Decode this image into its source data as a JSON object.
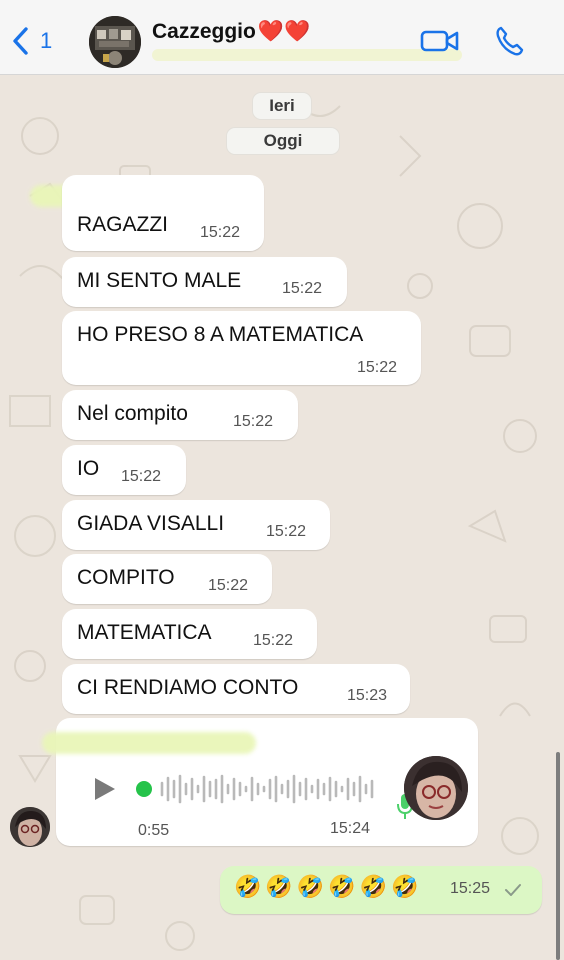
{
  "header": {
    "back_count": "1",
    "title": "Cazzeggio",
    "title_emoji": "❤️❤️"
  },
  "dates": {
    "yesterday": "Ieri",
    "today": "Oggi"
  },
  "messages": [
    {
      "text": "RAGAZZI",
      "time": "15:22"
    },
    {
      "text": "MI SENTO MALE",
      "time": "15:22"
    },
    {
      "text": "HO PRESO 8 A MATEMATICA",
      "time": "15:22"
    },
    {
      "text": "Nel compito",
      "time": "15:22"
    },
    {
      "text": "IO",
      "time": "15:22"
    },
    {
      "text": "GIADA VISALLI",
      "time": "15:22"
    },
    {
      "text": "COMPITO",
      "time": "15:22"
    },
    {
      "text": "MATEMATICA",
      "time": "15:22"
    },
    {
      "text": "CI RENDIAMO CONTO",
      "time": "15:23"
    }
  ],
  "voice_message": {
    "duration": "0:55",
    "time": "15:24",
    "played_fraction": 0.0
  },
  "outgoing": {
    "text": "🤣🤣🤣🤣🤣🤣",
    "time": "15:25"
  },
  "colors": {
    "accent_blue": "#1a73e8",
    "outgoing_bubble": "#dcf7c5",
    "incoming_bubble": "#ffffff",
    "wallpaper": "#ece5dd",
    "voice_dot": "#25c34a"
  },
  "icons": [
    "chevron-left-icon",
    "video-camera-icon",
    "phone-icon",
    "play-icon",
    "microphone-icon",
    "check-icon"
  ]
}
